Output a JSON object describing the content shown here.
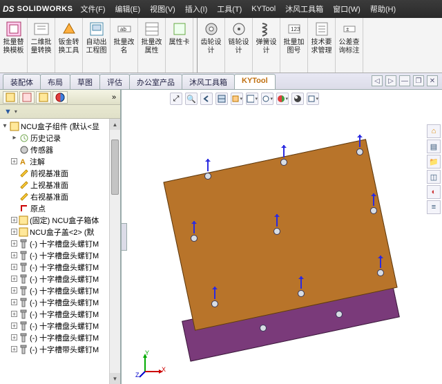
{
  "app": {
    "brand_ds": "DS",
    "brand_name": "SOLIDWORKS"
  },
  "menu": {
    "file": "文件(F)",
    "edit": "编辑(E)",
    "view": "视图(V)",
    "insert": "插入(I)",
    "tools": "工具(T)",
    "kytool": "KYTool",
    "mufeng": "沐风工具箱",
    "window": "窗口(W)",
    "help": "帮助(H)"
  },
  "cmd": {
    "c1": "批量替\n换模板",
    "c2": "二维批\n量转换",
    "c3": "钣金转\n换工具",
    "c4": "自动出\n工程图",
    "c5": "批量改\n名",
    "c6": "批量改\n属性",
    "c7": "属性卡",
    "c8": "齿轮设\n计",
    "c9": "链轮设\n计",
    "c10": "弹簧设\n计",
    "c11": "批量加\n图号",
    "c12": "技术要\n求管理",
    "c13": "公差查\n询标注"
  },
  "tabs": {
    "t1": "装配体",
    "t2": "布局",
    "t3": "草图",
    "t4": "评估",
    "t5": "办公室产品",
    "t6": "沐风工具箱",
    "t7": "KYTool"
  },
  "win_controls": {
    "prev": "◁",
    "next": "▷",
    "min": "—",
    "restore": "❐",
    "close": "✕"
  },
  "filter": {
    "funnel": "▼",
    "dd": "▾"
  },
  "tree": {
    "root": "NCU盒子组件  (默认<显",
    "history": "历史记录",
    "sensors": "传感器",
    "annotations": "注解",
    "front": "前视基准面",
    "top": "上视基准面",
    "right": "右视基准面",
    "origin": "原点",
    "fixed_box": "(固定) NCU盒子箱体",
    "lid": "NCU盒子盖<2> (默",
    "screw": "(-) 十字槽盘头螺钉M",
    "screw_last": "(-) 十字槽带头螺钉M"
  },
  "triad": {
    "x": "X",
    "y": "Y",
    "z": "Z"
  },
  "icons": {
    "cmd_generic": "⌘",
    "search": "🔍",
    "zoom_fit": "⤢",
    "section": "✂",
    "view_orient": "⬚",
    "display_style": "▦",
    "scene": "◐",
    "appearance": "●",
    "render": "✦",
    "home": "🏠",
    "layers": "≣",
    "paint": "🖌",
    "arrow": "➤",
    "more": "⋯"
  }
}
